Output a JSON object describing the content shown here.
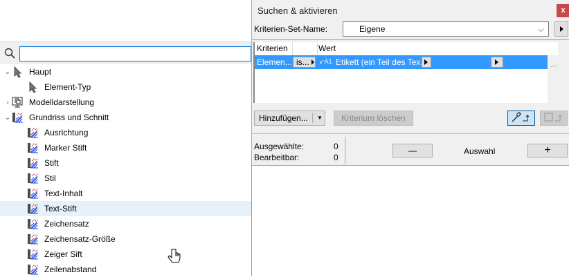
{
  "left_panel": {
    "search": {
      "value": "",
      "placeholder": ""
    },
    "tree": [
      {
        "label": "Haupt",
        "level": 0,
        "expanded": true,
        "icon": "arrow-cursor-icon"
      },
      {
        "label": "Element-Typ",
        "level": 1,
        "icon": "arrow-cursor-icon"
      },
      {
        "label": "Modelldarstellung",
        "level": 0,
        "expanded": false,
        "icon": "model-display-icon"
      },
      {
        "label": "Grundriss und Schnitt",
        "level": 0,
        "expanded": true,
        "icon": "floorplan-section-icon"
      },
      {
        "label": "Ausrichtung",
        "level": 1,
        "icon": "floorplan-section-icon"
      },
      {
        "label": "Marker Stift",
        "level": 1,
        "icon": "floorplan-section-icon"
      },
      {
        "label": "Stift",
        "level": 1,
        "icon": "floorplan-section-icon"
      },
      {
        "label": "Stil",
        "level": 1,
        "icon": "floorplan-section-icon"
      },
      {
        "label": "Text-Inhalt",
        "level": 1,
        "icon": "floorplan-section-icon"
      },
      {
        "label": "Text-Stift",
        "level": 1,
        "icon": "floorplan-section-icon",
        "selected": true
      },
      {
        "label": "Zeichensatz",
        "level": 1,
        "icon": "floorplan-section-icon"
      },
      {
        "label": "Zeichensatz-Größe",
        "level": 1,
        "icon": "floorplan-section-icon"
      },
      {
        "label": "Zeiger Sift",
        "level": 1,
        "icon": "floorplan-section-icon"
      },
      {
        "label": "Zeilenabstand",
        "level": 1,
        "icon": "floorplan-section-icon"
      }
    ]
  },
  "dialog": {
    "title": "Suchen & aktivieren",
    "close": "x",
    "set_label": "Kriterien-Set-Name:",
    "set_value": "Eigene",
    "columns": [
      "Kriterien",
      "Wert"
    ],
    "row": {
      "criterion": "Elemen...",
      "operator": "is...",
      "value_icon": "↙A1",
      "value": "Etikett (ein Teil des Tex..."
    },
    "add_button": "Hinzufügen...",
    "delete_button": "Kriterium löschen",
    "selected_label": "Ausgewählte:",
    "selected_count": "0",
    "editable_label": "Bearbeitbar:",
    "editable_count": "0",
    "minus": "—",
    "selection_label": "Auswahl",
    "plus": "+",
    "accent": "#3399ff"
  }
}
